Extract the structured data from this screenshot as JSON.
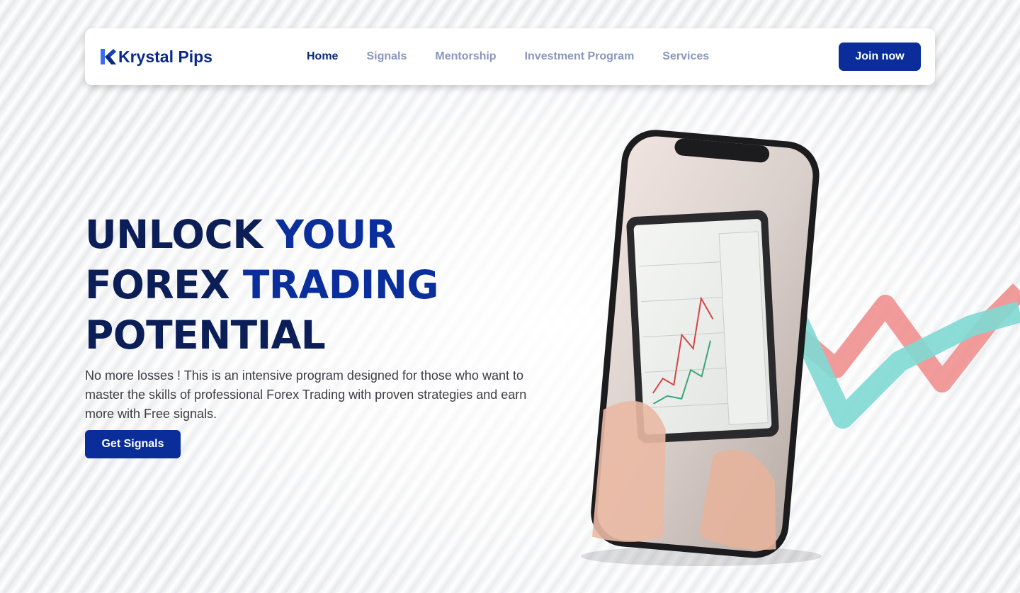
{
  "brand": {
    "name": "Krystal Pips",
    "logo_icon": "k-logo-icon"
  },
  "nav": {
    "items": [
      {
        "label": "Home",
        "active": true
      },
      {
        "label": "Signals",
        "active": false
      },
      {
        "label": "Mentorship",
        "active": false
      },
      {
        "label": "Investment Program",
        "active": false
      },
      {
        "label": "Services",
        "active": false
      }
    ],
    "join_label": "Join now"
  },
  "hero": {
    "title_line1_a": "UNLOCK ",
    "title_line1_b": "YOUR",
    "title_line2_a": "FOREX ",
    "title_line2_b": "TRADING",
    "title_line3": "POTENTIAL",
    "description": "No more losses !  This is an intensive program designed for  those who want to master the skills of professional Forex Trading with proven strategies and earn more with Free signals.",
    "cta_label": "Get Signals"
  },
  "colors": {
    "primary": "#0a2d9a",
    "heading_dark": "#0b1e57",
    "nav_inactive": "#8a96bd",
    "chart_teal": "#7fd9d3",
    "chart_red": "#ef8a8a"
  }
}
